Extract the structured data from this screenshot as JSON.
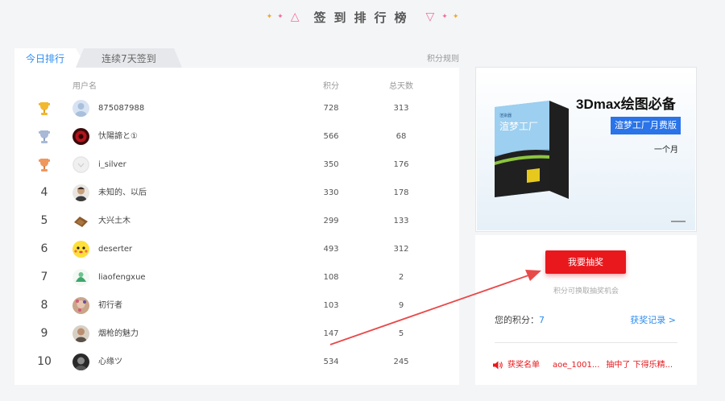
{
  "page_title": "签到排行榜",
  "tabs": {
    "today": "今日排行",
    "streak": "连续7天签到"
  },
  "rules_link": "积分规则",
  "table_headers": {
    "user": "用户名",
    "score": "积分",
    "days": "总天数"
  },
  "rows": [
    {
      "rank": "",
      "medal": "gold",
      "name": "875087988",
      "score": "728",
      "days": "313"
    },
    {
      "rank": "",
      "medal": "silver",
      "name": "忕陽諦と①",
      "score": "566",
      "days": "68"
    },
    {
      "rank": "",
      "medal": "bronze",
      "name": "i_silver",
      "score": "350",
      "days": "176"
    },
    {
      "rank": "4",
      "name": "未知的、以后",
      "score": "330",
      "days": "178"
    },
    {
      "rank": "5",
      "name": "大兴土木",
      "score": "299",
      "days": "133"
    },
    {
      "rank": "6",
      "name": "deserter",
      "score": "493",
      "days": "312"
    },
    {
      "rank": "7",
      "name": "liaofengxue",
      "score": "108",
      "days": "2"
    },
    {
      "rank": "8",
      "name": "初行者",
      "score": "103",
      "days": "9"
    },
    {
      "rank": "9",
      "name": "烟枪的魅力",
      "score": "147",
      "days": "5"
    },
    {
      "rank": "10",
      "name": "心缘ツ",
      "score": "534",
      "days": "245"
    }
  ],
  "ad": {
    "title": "3Dmax绘图必备",
    "tag": "渲梦工厂月费版",
    "sub": "一个月",
    "box_brand": "渲梦工厂",
    "box_small": "渲染器"
  },
  "lottery": {
    "button": "我要抽奖",
    "hint": "积分可换取抽奖机会",
    "points_label": "您的积分：",
    "points_value": "7",
    "record_link": "获奖记录 >",
    "winners_label": "获奖名单",
    "winner_user": "aoe_1001...",
    "winner_text": "抽中了 下得乐精..."
  },
  "colors": {
    "accent": "#2d8cf0",
    "button": "#e8181d",
    "title_deco": "#f26e9a",
    "arrow": "#e84a4a"
  }
}
